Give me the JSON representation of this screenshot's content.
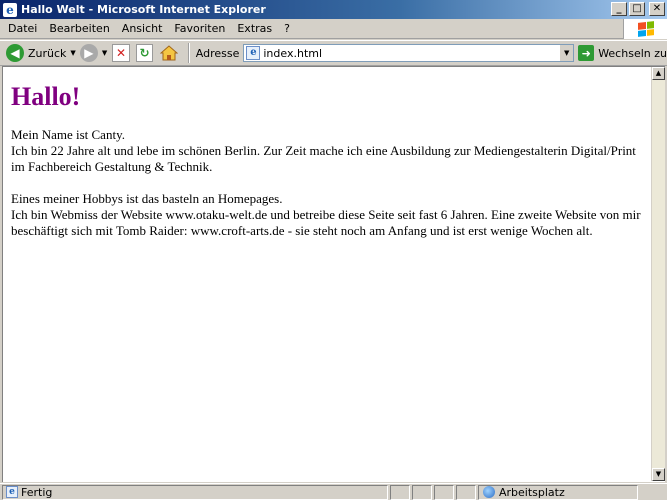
{
  "window": {
    "title": "Hallo Welt - Microsoft Internet Explorer",
    "controls": {
      "minimize": "_",
      "maximize": "□",
      "close": "✕"
    }
  },
  "menu": {
    "items": [
      "Datei",
      "Bearbeiten",
      "Ansicht",
      "Favoriten",
      "Extras",
      "?"
    ]
  },
  "toolbar": {
    "back_label": "Zurück",
    "address_label": "Adresse",
    "address_value": "index.html",
    "go_label": "Wechseln zu",
    "icons": [
      "back-icon",
      "forward-icon",
      "stop-icon",
      "refresh-icon",
      "home-icon"
    ]
  },
  "page": {
    "heading": "Hallo!",
    "heading_color": "#800080",
    "para1_line1": "Mein Name ist Canty.",
    "para1_line2": "Ich bin 22 Jahre alt und lebe im schönen Berlin. Zur Zeit mache ich eine Ausbildung zur Mediengestalterin Digital/Print im Fachbereich Gestaltung & Technik.",
    "para2_line1": "Eines meiner Hobbys ist das basteln an Homepages.",
    "para2_line2": "Ich bin Webmiss der Website www.otaku-welt.de und betreibe diese Seite seit fast 6 Jahren. Eine zweite Website von mir beschäftigt sich mit Tomb Raider: www.croft-arts.de - sie steht noch am Anfang und ist erst wenige Wochen alt."
  },
  "status": {
    "text": "Fertig",
    "zone": "Arbeitsplatz"
  }
}
